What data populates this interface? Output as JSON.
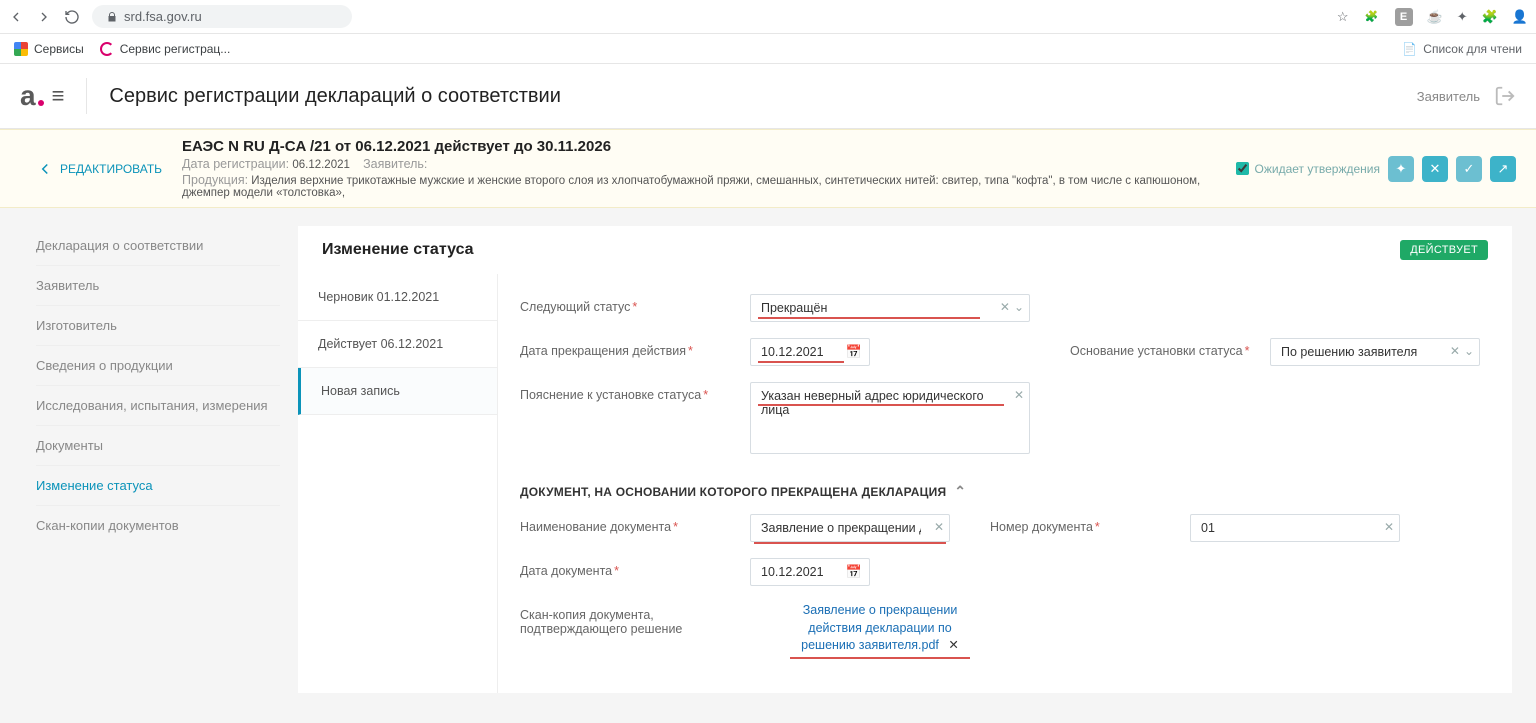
{
  "browser": {
    "url": "srd.fsa.gov.ru",
    "bookmarks": {
      "services": "Сервисы",
      "service_reg": "Сервис регистрац...",
      "reading_list": "Список для чтени"
    }
  },
  "app": {
    "title": "Сервис регистрации деклараций о соответствии",
    "role": "Заявитель"
  },
  "info": {
    "edit_back": "РЕДАКТИРОВАТЬ",
    "decl_title": "ЕАЭС N RU Д-CA                         /21 от 06.12.2021 действует до 30.11.2026",
    "reg_date_label": "Дата регистрации:",
    "reg_date": "06.12.2021",
    "applicant_label": "Заявитель:",
    "product_label": "Продукция:",
    "product": "Изделия верхние трикотажные мужские и женские второго слоя из хлопчатобумажной пряжи, смешанных, синтетических нитей: свитер, типа \"кофта\", в том числе с капюшоном, джемпер модели «толстовка»,",
    "pending": "Ожидает утверждения"
  },
  "sidebar": {
    "items": [
      "Декларация о соответствии",
      "Заявитель",
      "Изготовитель",
      "Сведения о продукции",
      "Исследования, испытания, измерения",
      "Документы",
      "Изменение статуса",
      "Скан-копии документов"
    ],
    "active_index": 6
  },
  "panel": {
    "title": "Изменение статуса",
    "badge": "ДЕЙСТВУЕТ",
    "history": [
      "Черновик 01.12.2021",
      "Действует 06.12.2021",
      "Новая запись"
    ],
    "history_active": 2
  },
  "form": {
    "next_status_label": "Следующий статус",
    "next_status": "Прекращён",
    "end_date_label": "Дата прекращения действия",
    "end_date": "10.12.2021",
    "basis_label": "Основание установки статуса",
    "basis": "По решению заявителя",
    "note_label": "Пояснение к установке статуса",
    "note": "Указан неверный адрес юридического лица",
    "doc_section": "ДОКУМЕНТ, НА ОСНОВАНИИ КОТОРОГО ПРЕКРАЩЕНА ДЕКЛАРАЦИЯ",
    "doc_name_label": "Наименование документа",
    "doc_name": "Заявление о прекращении д",
    "doc_num_label": "Номер документа",
    "doc_num": "01",
    "doc_date_label": "Дата документа",
    "doc_date": "10.12.2021",
    "scan_label": "Скан-копия документа, подтверждающего решение",
    "scan_file": "Заявление о прекращении действия декларации по решению заявителя.pdf"
  }
}
